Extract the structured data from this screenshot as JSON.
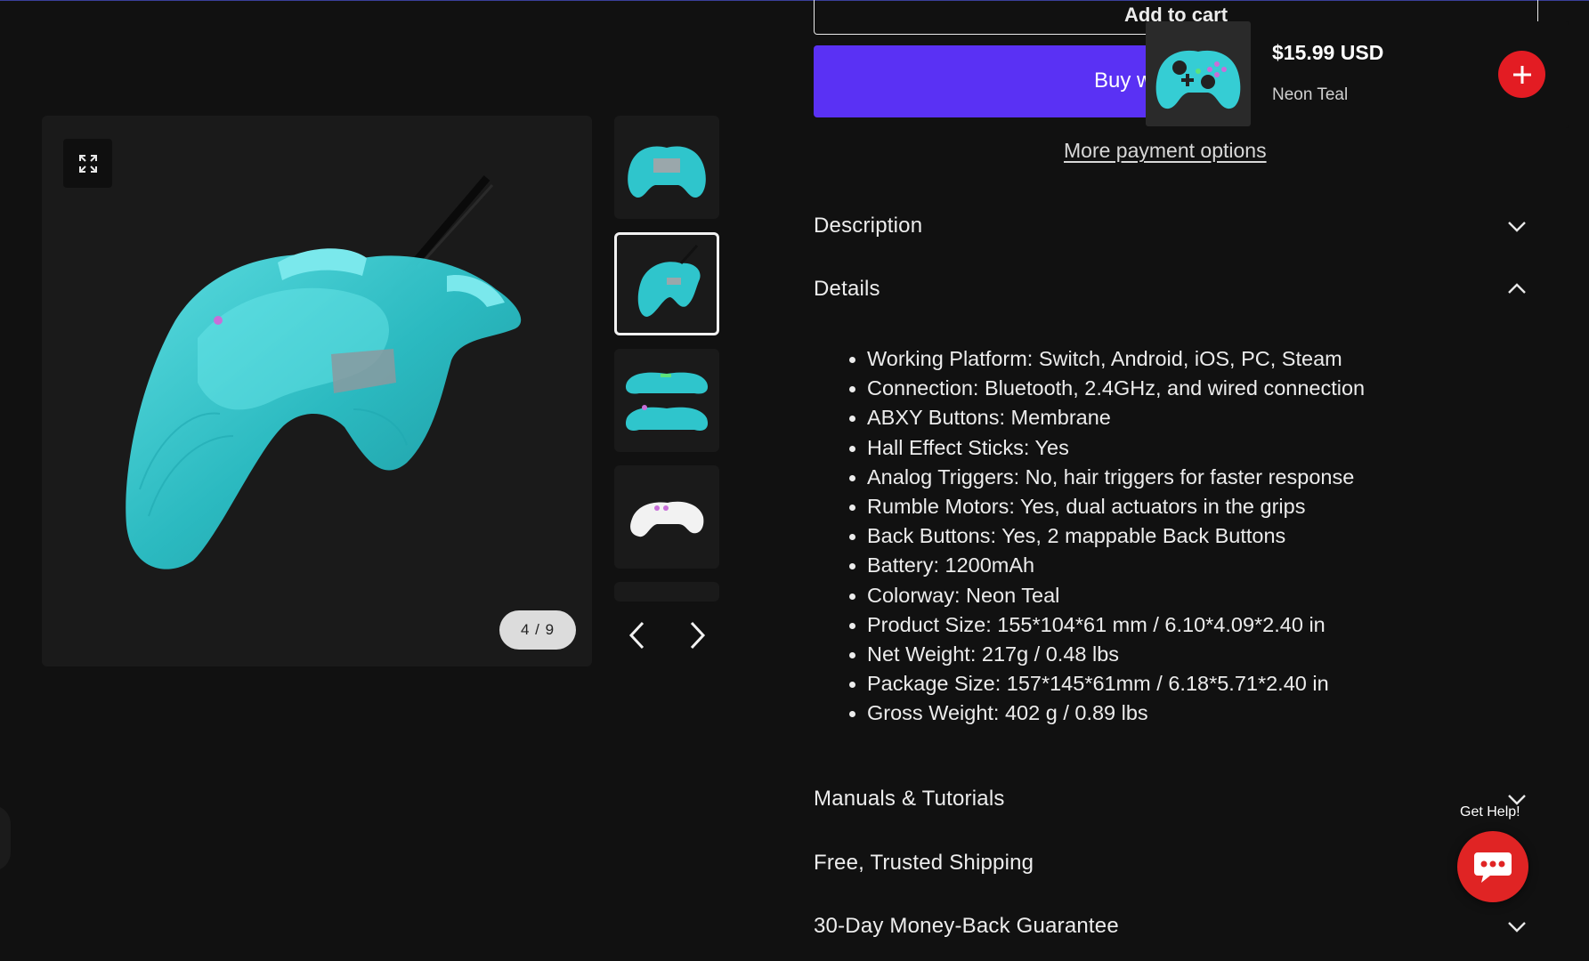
{
  "product_form": {
    "add_to_cart_label": "Add to cart",
    "buy_now_label": "Buy with",
    "more_payment_label": "More payment options"
  },
  "sticky_bar": {
    "price": "$15.99 USD",
    "variant": "Neon Teal",
    "add_icon": "plus-icon",
    "image_icon": "controller-image"
  },
  "gallery": {
    "counter": "4 / 9",
    "zoom_icon": "expand-icon",
    "prev_icon": "chevron-left-icon",
    "next_icon": "chevron-right-icon",
    "thumbnails": [
      {
        "name": "thumb-teal-back"
      },
      {
        "name": "thumb-teal-side"
      },
      {
        "name": "thumb-teal-pair"
      },
      {
        "name": "thumb-white-side"
      }
    ],
    "active_thumb": 1
  },
  "accordions": {
    "description": "Description",
    "details": "Details",
    "manuals": "Manuals & Tutorials",
    "shipping": "Free, Trusted Shipping",
    "guarantee": "30-Day Money-Back Guarantee"
  },
  "details_items": [
    "Working Platform: Switch, Android, iOS, PC, Steam",
    "Connection: Bluetooth, 2.4GHz, and wired connection",
    "ABXY Buttons: Membrane",
    "Hall Effect Sticks: Yes",
    "Analog Triggers: No, hair triggers for faster response",
    "Rumble Motors: Yes, dual actuators in the grips",
    "Back Buttons: Yes, 2 mappable Back Buttons",
    "Battery: 1200mAh",
    "Colorway: Neon Teal",
    "Product Size: 155*104*61 mm / 6.10*4.09*2.40 in",
    "Net Weight: 217g / 0.48 lbs",
    "Package Size: 157*145*61mm / 6.18*5.71*2.40 in",
    "Gross Weight: 402 g / 0.89 lbs"
  ],
  "help": {
    "label": "Get Help!",
    "icon": "chat-bubble-icon"
  },
  "colors": {
    "background": "#111111",
    "buy_button": "#5a31f4",
    "accent_red": "#e31c23",
    "controller_teal": "#3fd3d8"
  }
}
